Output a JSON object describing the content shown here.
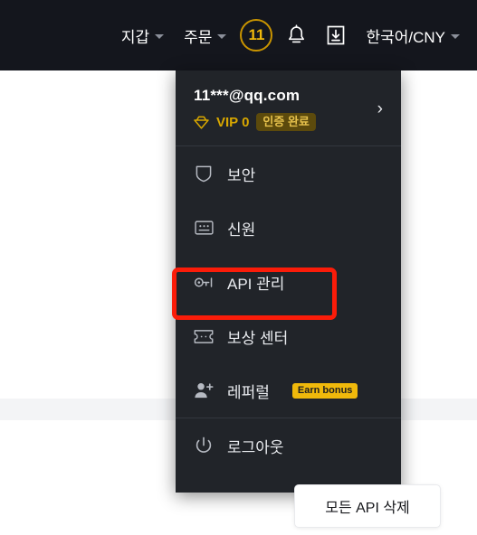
{
  "topbar": {
    "background_color": "#14161d",
    "items": [
      {
        "label": "지갑",
        "icon": "chevron-down-icon",
        "has_caret": true
      },
      {
        "label": "주문",
        "icon": "chevron-down-icon",
        "has_caret": true
      }
    ],
    "notification_count": "11",
    "notification_color": "#f0b90b",
    "bell_icon": "bell-icon",
    "download_icon": "download-inbox-icon",
    "language": {
      "label": "한국어/CNY",
      "has_caret": true
    }
  },
  "dropdown": {
    "background_color": "#212429",
    "account": {
      "email": "11***@qq.com",
      "vip_label": "VIP 0",
      "vip_color": "#d8a700",
      "verified_badge": "인증 완료",
      "verified_badge_bg": "#5c4a0c",
      "chevron": "›"
    },
    "items": [
      {
        "label": "보안",
        "icon": "shield-icon",
        "badge": null,
        "highlighted": false
      },
      {
        "label": "신원",
        "icon": "id-card-icon",
        "badge": null,
        "highlighted": false
      },
      {
        "label": "API 관리",
        "icon": "api-key-icon",
        "badge": null,
        "highlighted": true
      },
      {
        "label": "보상 센터",
        "icon": "ticket-icon",
        "badge": null,
        "highlighted": false
      },
      {
        "label": "레퍼럴",
        "icon": "user-plus-icon",
        "badge": "Earn bonus",
        "highlighted": false
      },
      {
        "label": "로그아웃",
        "icon": "power-icon",
        "badge": null,
        "highlighted": false
      }
    ]
  },
  "annotation": {
    "highlight_color": "#fb1c09",
    "target_label": "API 관리"
  },
  "delete_button": {
    "label": "모든 API 삭제"
  }
}
